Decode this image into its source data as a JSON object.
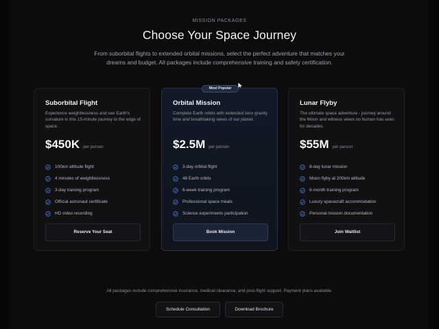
{
  "header": {
    "eyebrow": "MISSION PACKAGES",
    "title": "Choose Your Space Journey",
    "subtitle": "From suborbital flights to extended orbital missions, select the perfect adventure that matches your dreams and budget. All packages include comprehensive training and safety certification."
  },
  "packages": [
    {
      "name": "Suborbital Flight",
      "description": "Experience weightlessness and see Earth's curvature in this 15-minute journey to the edge of space.",
      "price": "$450K",
      "price_unit": "per person",
      "features": [
        "100km altitude flight",
        "4 minutes of weightlessness",
        "3-day training program",
        "Official astronaut certificate",
        "HD video recording"
      ],
      "cta": "Reserve Your Seat"
    },
    {
      "badge": "Most Popular",
      "name": "Orbital Mission",
      "description": "Complete Earth orbits with extended zero gravity time and breathtaking views of our planet.",
      "price": "$2.5M",
      "price_unit": "per person",
      "features": [
        "3-day orbital flight",
        "48 Earth orbits",
        "6-week training program",
        "Professional space meals",
        "Science experiments participation"
      ],
      "cta": "Book Mission"
    },
    {
      "name": "Lunar Flyby",
      "description": "The ultimate space adventure - journey around the Moon and witness views no human has seen for decades.",
      "price": "$55M",
      "price_unit": "per person",
      "features": [
        "8-day lunar mission",
        "Moon flyby at 200km altitude",
        "6-month training program",
        "Luxury spacecraft accommodation",
        "Personal mission documentation"
      ],
      "cta": "Join Waitlist"
    }
  ],
  "footer": {
    "note": "All packages include comprehensive insurance, medical clearance, and post-flight support. Payment plans available.",
    "schedule_label": "Schedule Consultation",
    "brochure_label": "Download Brochure"
  },
  "icons": {
    "feature": "check-circle-icon",
    "pointer": "cursor-arrow-icon"
  },
  "colors": {
    "background": "#0c0c0e",
    "card": "#111114",
    "featured_card": "#121a28",
    "check": "#4f7ed8",
    "text": "#f4f4f6",
    "muted": "#9a9aa3"
  }
}
